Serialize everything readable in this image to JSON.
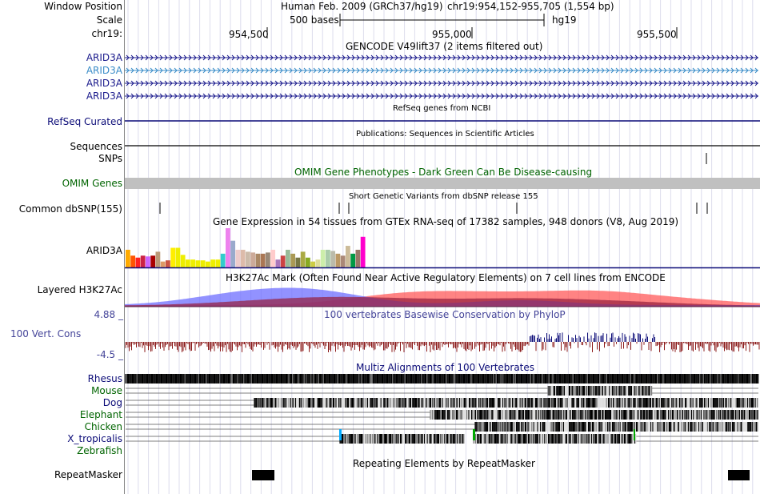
{
  "header": {
    "window_position_label": "Window Position",
    "scale_label": "Scale",
    "chrom_label": "chr19:",
    "assembly": "Human Feb. 2009 (GRCh37/hg19)",
    "position": "chr19:954,152-955,705 (1,554 bp)",
    "scale_text": "500 bases",
    "scale_db": "hg19",
    "ticks": [
      "954,500",
      "955,000",
      "955,500"
    ]
  },
  "gencode": {
    "title": "GENCODE V49lift37 (2 items filtered out)",
    "transcripts": [
      {
        "label": "ARID3A",
        "color": "#1a1a8c"
      },
      {
        "label": "ARID3A",
        "color": "#3a8cc8"
      },
      {
        "label": "ARID3A",
        "color": "#1a1a8c"
      },
      {
        "label": "ARID3A",
        "color": "#1a1a8c"
      }
    ]
  },
  "refseq": {
    "title": "RefSeq genes from NCBI",
    "label": "RefSeq Curated",
    "color": "#0c0c78"
  },
  "publications": {
    "title": "Publications: Sequences in Scientific Articles",
    "label": "Sequences"
  },
  "snps_label": "SNPs",
  "omim": {
    "title": "OMIM Gene Phenotypes - Dark Green Can Be Disease-causing",
    "label": "OMIM Genes",
    "color": "#006400",
    "bar_color": "#c0c0c0"
  },
  "dbsnp": {
    "title": "Short Genetic Variants from dbSNP release 155",
    "label": "Common dbSNP(155)"
  },
  "gtex": {
    "title": "Gene Expression in 54 tissues from GTEx RNA-seq of 17382 samples, 948 donors (V8, Aug 2019)",
    "label": "ARID3A",
    "tissues": [
      {
        "value": 0.45,
        "color": "#ffaa00"
      },
      {
        "value": 0.3,
        "color": "#ff5500"
      },
      {
        "value": 0.25,
        "color": "#ff2222"
      },
      {
        "value": 0.3,
        "color": "#cc2244"
      },
      {
        "value": 0.28,
        "color": "#cc66ff"
      },
      {
        "value": 0.3,
        "color": "#aa0000"
      },
      {
        "value": 0.4,
        "color": "#bb9977"
      },
      {
        "value": 0.15,
        "color": "#dd9966"
      },
      {
        "value": 0.18,
        "color": "#cc5544"
      },
      {
        "value": 0.5,
        "color": "#ffee00"
      },
      {
        "value": 0.5,
        "color": "#eeee00"
      },
      {
        "value": 0.32,
        "color": "#eeee00"
      },
      {
        "value": 0.2,
        "color": "#eeee00"
      },
      {
        "value": 0.2,
        "color": "#eeee00"
      },
      {
        "value": 0.18,
        "color": "#eeee00"
      },
      {
        "value": 0.18,
        "color": "#eeee00"
      },
      {
        "value": 0.15,
        "color": "#eeee00"
      },
      {
        "value": 0.2,
        "color": "#eeee00"
      },
      {
        "value": 0.2,
        "color": "#eeee00"
      },
      {
        "value": 0.35,
        "color": "#33cccc"
      },
      {
        "value": 1.0,
        "color": "#ee82ee"
      },
      {
        "value": 0.68,
        "color": "#99aacc"
      },
      {
        "value": 0.45,
        "color": "#eecccc"
      },
      {
        "value": 0.45,
        "color": "#ddbbaa"
      },
      {
        "value": 0.4,
        "color": "#ccbbaa"
      },
      {
        "value": 0.38,
        "color": "#ccaa99"
      },
      {
        "value": 0.35,
        "color": "#aa8866"
      },
      {
        "value": 0.35,
        "color": "#aa7755"
      },
      {
        "value": 0.38,
        "color": "#998877"
      },
      {
        "value": 0.45,
        "color": "#ffcccc"
      },
      {
        "value": 0.2,
        "color": "#aa77bb"
      },
      {
        "value": 0.3,
        "color": "#cc4444"
      },
      {
        "value": 0.45,
        "color": "#99bb99"
      },
      {
        "value": 0.35,
        "color": "#aa9955"
      },
      {
        "value": 0.25,
        "color": "#777744"
      },
      {
        "value": 0.4,
        "color": "#aaaa44"
      },
      {
        "value": 0.25,
        "color": "#88aa22"
      },
      {
        "value": 0.15,
        "color": "#cccc44"
      },
      {
        "value": 0.2,
        "color": "#dddd99"
      },
      {
        "value": 0.45,
        "color": "#cceeaa"
      },
      {
        "value": 0.45,
        "color": "#aaccaa"
      },
      {
        "value": 0.42,
        "color": "#bbbbaa"
      },
      {
        "value": 0.35,
        "color": "#bb9966"
      },
      {
        "value": 0.3,
        "color": "#aa8877"
      },
      {
        "value": 0.55,
        "color": "#ccbb99"
      },
      {
        "value": 0.35,
        "color": "#009944"
      },
      {
        "value": 0.45,
        "color": "#997766"
      },
      {
        "value": 0.78,
        "color": "#ff00cc"
      }
    ]
  },
  "h3k27ac": {
    "title": "H3K27Ac Mark (Often Found Near Active Regulatory Elements) on 7 cell lines from ENCODE",
    "label": "Layered H3K27Ac"
  },
  "phylop": {
    "title": "100 vertebrates Basewise Conservation by PhyloP",
    "label": "100 Vert. Cons",
    "ymax": "4.88 _",
    "ymin": "-4.5 _",
    "color": "#444499",
    "pos_color": "#0c0c78",
    "neg_color": "#8b1a1a"
  },
  "multiz": {
    "title": "Multiz Alignments of 100 Vertebrates",
    "title_color": "#0c0c78",
    "species": [
      {
        "label": "Rhesus",
        "color": "#0c0c78"
      },
      {
        "label": "Mouse",
        "color": "#006400"
      },
      {
        "label": "Dog",
        "color": "#0c0c78"
      },
      {
        "label": "Elephant",
        "color": "#006400"
      },
      {
        "label": "Chicken",
        "color": "#006400"
      },
      {
        "label": "X_tropicalis",
        "color": "#0c0c78"
      },
      {
        "label": "Zebrafish",
        "color": "#006400"
      }
    ]
  },
  "repeatmasker": {
    "title": "Repeating Elements by RepeatMasker",
    "label": "RepeatMasker"
  }
}
